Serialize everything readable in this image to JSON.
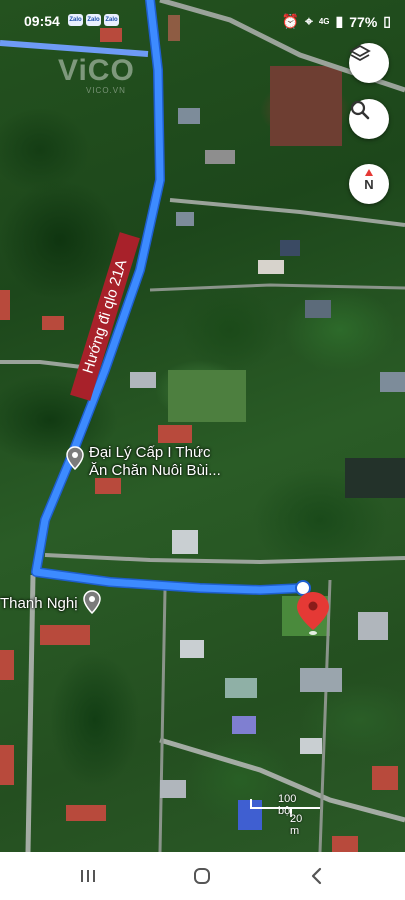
{
  "status_bar": {
    "time": "09:54",
    "apps": [
      "Zalo",
      "Zalo",
      "Zalo"
    ],
    "network": "4G",
    "battery": "77%"
  },
  "watermark": {
    "brand": "ViCO",
    "sub": "VICO.VN"
  },
  "map": {
    "road_label": "Hướng đi qlo 21A",
    "places": [
      {
        "name_line1": "Đại Lý Cấp I Thức",
        "name_line2": "Ăn Chăn Nuôi Bùi..."
      },
      {
        "name_line1": "Thanh Nghị"
      }
    ],
    "route_color": "#3d8bff",
    "destination_pin_color": "#e53935"
  },
  "controls": {
    "layers_icon": "layers-icon",
    "search_icon": "search-icon",
    "compass_letter": "N"
  },
  "scale": {
    "feet": "100 bộ",
    "meters": "20 m"
  },
  "nav_bar": {
    "recents_icon": "recents-icon",
    "home_icon": "home-icon",
    "back_icon": "back-icon"
  }
}
